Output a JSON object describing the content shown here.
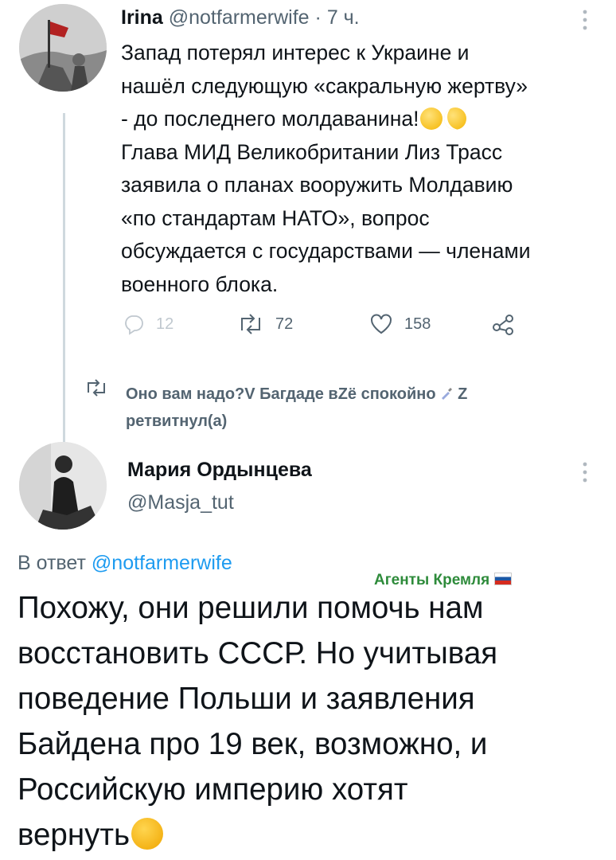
{
  "tweet1": {
    "name": "Irina",
    "handle": "@notfarmerwife",
    "separator": "·",
    "time": "7 ч.",
    "lines": [
      "Запад потерял интерес к Украине и",
      "нашёл следующую «сакральную жертву»",
      "- до последнего молдаванина!",
      "Глава МИД Великобритании Лиз Трасс",
      "заявила о планах вооружить Молдавию",
      "«по стандартам НАТО», вопрос",
      "обсуждается с государствами — членами",
      "военного блока."
    ],
    "emojis": [
      "smirk-emoji",
      "monocle-face-emoji"
    ],
    "actions": {
      "replies": "12",
      "retweets": "72",
      "likes": "158"
    }
  },
  "retweet_banner": {
    "line1": "Оно вам надо?V Багдаде вZё спокойно",
    "line1_suffix": " Z",
    "line2": "ретвитнул(а)"
  },
  "tweet2": {
    "name": "Мария Ордынцева",
    "handle": "@Masja_tut",
    "reply_prefix": "В ответ",
    "reply_handle": "@notfarmerwife",
    "lines": [
      "Похожу, они решили помочь нам",
      "восстановить СССР. Но учитывая",
      "поведение Польши и заявления",
      "Байдена про 19 век, возможно, и",
      "Российскую империю хотят",
      "вернуть"
    ],
    "emoji": "thinking-face-emoji"
  },
  "watermark": "Агенты Кремля",
  "colors": {
    "text": "#0f1419",
    "muted": "#536471",
    "link": "#1d9bf0",
    "icon": "#8b98a5",
    "watermark": "#2e8b3b"
  }
}
